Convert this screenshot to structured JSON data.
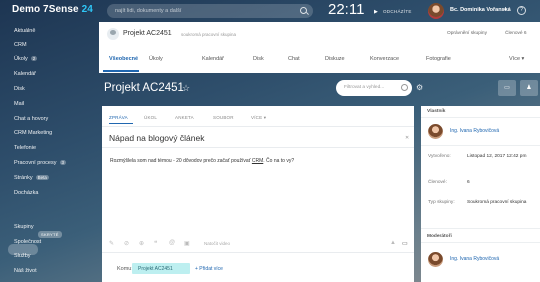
{
  "topbar": {
    "logo_text": "Demo 7Sense",
    "logo_num": "24",
    "search_placeholder": "najít lidi, dokumenty a další",
    "clock": "22:11",
    "workday": "ODCHÁZÍTE",
    "username": "Bc. Dominika Vořanská",
    "help": "?"
  },
  "sidebar": {
    "items": [
      {
        "label": "Aktuálně"
      },
      {
        "label": "CRM"
      },
      {
        "label": "Úkoly",
        "badge": "2"
      },
      {
        "label": "Kalendář"
      },
      {
        "label": "Disk"
      },
      {
        "label": "Mail"
      },
      {
        "label": "Chat a hovory"
      },
      {
        "label": "CRM Marketing"
      },
      {
        "label": "Telefonie"
      },
      {
        "label": "Pracovní procesy",
        "badge": "3"
      },
      {
        "label": "Stránky",
        "badge": "Beta"
      },
      {
        "label": "Docházka"
      },
      {
        "label": "Skupiny"
      },
      {
        "label": "Společnost"
      },
      {
        "label": "Služby"
      },
      {
        "label": "Náš život"
      }
    ],
    "hidden_label": "SKRYTÉ"
  },
  "project": {
    "title_small": "Projekt AC2451",
    "subtitle": "soukromá pracovní skupina",
    "access": "Oprávnění skupiny",
    "members": "Členové 6",
    "tabs": [
      "Všeobecné",
      "Úkoly",
      "Kalendář",
      "Disk",
      "Chat",
      "Diskuze",
      "Konverzace",
      "Fotografie",
      "Více"
    ]
  },
  "page": {
    "title": "Projekt AC2451",
    "filter_placeholder": "Filtrovat a vyhled..."
  },
  "composer": {
    "tabs": [
      "ZPRÁVA",
      "ÚKOL",
      "ANKETA",
      "SOUBOR",
      "VÍCE"
    ],
    "subject": "Nápad na blogový článek",
    "body_before": "Rozmýšlela som nad témou - 20 dôvodov prečo začať používať ",
    "body_link": "CRM",
    "body_after": ". Čo na to vy?",
    "toolbar_label": "Natočit video",
    "recipients_label": "Komu:",
    "recipient_chip": "Projekt AC2451",
    "add_more": "+ Přidat více"
  },
  "rpanel": {
    "owner_head": "Vlastník",
    "owner_name": "Ing. Ivana Rybovičová",
    "created_label": "Vytvořeno:",
    "created_value": "Listopad 12, 2017 12:42 pm",
    "members_label": "Členové:",
    "members_value": "6",
    "type_label": "Typ skupiny:",
    "type_value": "Soukromá pracovní skupina",
    "moderators_head": "Moderátoři",
    "moderator_name": "Ing. Ivana Rybovičová"
  },
  "colors": {
    "accent": "#2067b0",
    "logo_num": "#2fc6f6",
    "chip": "#bdeff0"
  }
}
